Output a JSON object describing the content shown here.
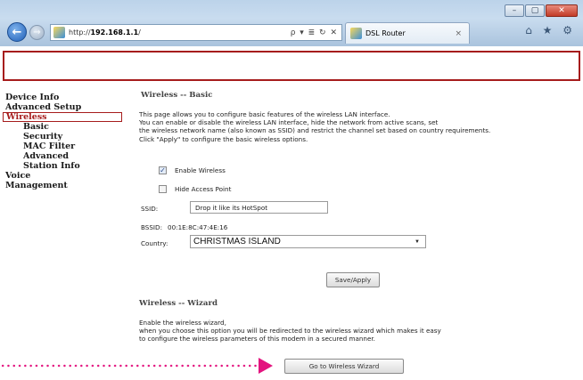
{
  "browser": {
    "url_prefix": "http://",
    "url_host": "192.168.1.1",
    "url_suffix": "/",
    "address_icons": "ρ ▾ ≣ ↻ ✕",
    "tab_title": "DSL Router",
    "tab_close": "×",
    "window_controls": {
      "minimize": "–",
      "maximize": "▢",
      "close": "✕"
    },
    "nav": {
      "back": "←",
      "forward": "→"
    },
    "toolbar_icons": "⌂ ★ ⚙"
  },
  "sidebar": {
    "items": [
      {
        "label": "Device Info"
      },
      {
        "label": "Advanced Setup"
      },
      {
        "label": "Wireless"
      },
      {
        "label": "Basic"
      },
      {
        "label": "Security"
      },
      {
        "label": "MAC Filter"
      },
      {
        "label": "Advanced"
      },
      {
        "label": "Station Info"
      },
      {
        "label": "Voice"
      },
      {
        "label": "Management"
      }
    ]
  },
  "basic": {
    "title": "Wireless -- Basic",
    "intro": [
      "This page allows you to configure basic features of the wireless LAN interface.",
      "You can enable or disable the wireless LAN interface, hide the network from active scans, set",
      "the wireless network name (also known as SSID) and restrict the channel set based on country requirements.",
      "Click \"Apply\" to configure the basic wireless options."
    ],
    "enable_wireless": {
      "label": "Enable Wireless",
      "checked": true,
      "mark": "✓"
    },
    "hide_access_point": {
      "label": "Hide Access Point",
      "checked": false
    },
    "ssid": {
      "label": "SSID:",
      "value": "Drop it like its HotSpot"
    },
    "bssid": {
      "label": "BSSID:",
      "value": "00:1E:8C:47:4E:16"
    },
    "country": {
      "label": "Country:",
      "value": "CHRISTMAS ISLAND",
      "arrow": "▼"
    },
    "save_button": "Save/Apply"
  },
  "wizard": {
    "title": "Wireless -- Wizard",
    "intro": [
      "Enable the wireless wizard,",
      "when you choose this option you will be redirected to the wireless wizard which makes it easy",
      "to configure the wireless parameters of this modem in a secured manner."
    ],
    "button": "Go to Wireless Wizard"
  },
  "colors": {
    "accent_red": "#a61c1c",
    "annotation_pink": "#e3147f"
  }
}
